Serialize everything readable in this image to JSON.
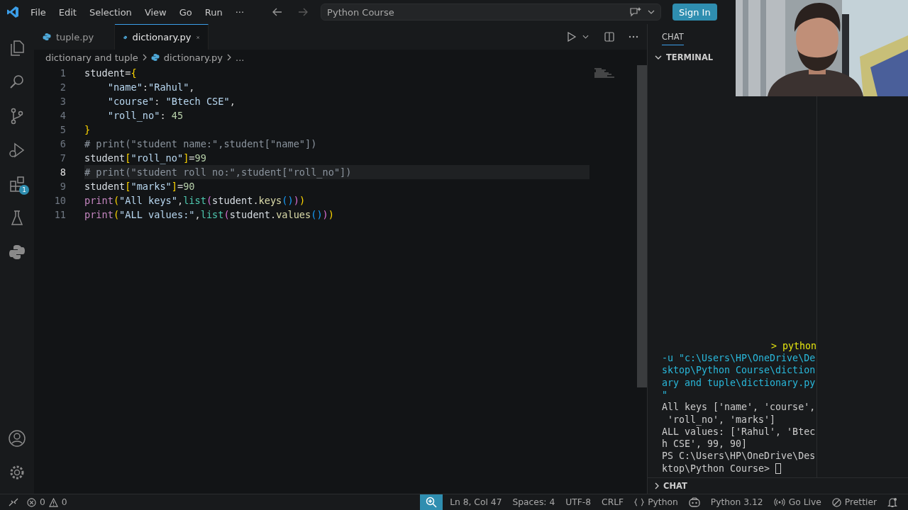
{
  "menu": [
    "File",
    "Edit",
    "Selection",
    "View",
    "Go",
    "Run",
    "···"
  ],
  "command_center": {
    "label": "Python Course"
  },
  "sign_in": "Sign In",
  "activity_bar": [
    {
      "kind": "files"
    },
    {
      "kind": "search"
    },
    {
      "kind": "source-control"
    },
    {
      "kind": "debug"
    },
    {
      "kind": "extensions",
      "badge": "1"
    },
    {
      "kind": "testing"
    },
    {
      "kind": "python"
    }
  ],
  "tabs": [
    {
      "label": "tuple.py",
      "selected": false
    },
    {
      "label": "dictionary.py",
      "selected": true
    }
  ],
  "breadcrumb": [
    "dictionary and tuple",
    "dictionary.py",
    "..."
  ],
  "code": [
    {
      "number": "1",
      "current": false,
      "tokens": [
        {
          "kind": "var",
          "text": "student"
        },
        {
          "kind": "op",
          "text": "="
        },
        {
          "kind": "brace",
          "text": "{"
        }
      ]
    },
    {
      "number": "2",
      "current": false,
      "tokens": [
        {
          "kind": "str",
          "text": "    \"name\""
        },
        {
          "kind": "op",
          "text": ":"
        },
        {
          "kind": "str",
          "text": "\"Rahul\""
        },
        {
          "kind": "op",
          "text": ","
        }
      ]
    },
    {
      "number": "3",
      "current": false,
      "tokens": [
        {
          "kind": "str",
          "text": "    \"course\""
        },
        {
          "kind": "op",
          "text": ": "
        },
        {
          "kind": "str",
          "text": "\"Btech CSE\""
        },
        {
          "kind": "op",
          "text": ","
        }
      ]
    },
    {
      "number": "4",
      "current": false,
      "tokens": [
        {
          "kind": "str",
          "text": "    \"roll_no\""
        },
        {
          "kind": "op",
          "text": ": "
        },
        {
          "kind": "num",
          "text": "45"
        }
      ]
    },
    {
      "number": "5",
      "current": false,
      "tokens": [
        {
          "kind": "brace",
          "text": "}"
        }
      ]
    },
    {
      "number": "6",
      "current": false,
      "tokens": [
        {
          "kind": "comment",
          "text": "# print(\"student name:\",student[\"name\"])"
        }
      ]
    },
    {
      "number": "7",
      "current": false,
      "tokens": [
        {
          "kind": "var",
          "text": "student"
        },
        {
          "kind": "brace",
          "text": "["
        },
        {
          "kind": "str",
          "text": "\"roll_no\""
        },
        {
          "kind": "brace",
          "text": "]"
        },
        {
          "kind": "op",
          "text": "="
        },
        {
          "kind": "num",
          "text": "99"
        }
      ]
    },
    {
      "number": "8",
      "current": true,
      "tokens": [
        {
          "kind": "comment",
          "text": "# print(\"student roll no:\",student[\"roll_no\"])"
        }
      ]
    },
    {
      "number": "9",
      "current": false,
      "tokens": [
        {
          "kind": "var",
          "text": "student"
        },
        {
          "kind": "brace",
          "text": "["
        },
        {
          "kind": "str",
          "text": "\"marks\""
        },
        {
          "kind": "brace",
          "text": "]"
        },
        {
          "kind": "op",
          "text": "="
        },
        {
          "kind": "num",
          "text": "90"
        }
      ]
    },
    {
      "number": "10",
      "current": false,
      "tokens": [
        {
          "kind": "keyword",
          "text": "print"
        },
        {
          "kind": "brace",
          "text": "("
        },
        {
          "kind": "str",
          "text": "\"All keys\""
        },
        {
          "kind": "op",
          "text": ","
        },
        {
          "kind": "type",
          "text": "list"
        },
        {
          "kind": "paren",
          "text": "("
        },
        {
          "kind": "var",
          "text": "student"
        },
        {
          "kind": "op",
          "text": "."
        },
        {
          "kind": "func",
          "text": "keys"
        },
        {
          "kind": "paren2",
          "text": "()"
        },
        {
          "kind": "paren",
          "text": ")"
        },
        {
          "kind": "brace",
          "text": ")"
        }
      ]
    },
    {
      "number": "11",
      "current": false,
      "tokens": [
        {
          "kind": "keyword",
          "text": "print"
        },
        {
          "kind": "brace",
          "text": "("
        },
        {
          "kind": "str",
          "text": "\"ALL values:\""
        },
        {
          "kind": "op",
          "text": ","
        },
        {
          "kind": "type",
          "text": "list"
        },
        {
          "kind": "paren",
          "text": "("
        },
        {
          "kind": "var",
          "text": "student"
        },
        {
          "kind": "op",
          "text": "."
        },
        {
          "kind": "func",
          "text": "values"
        },
        {
          "kind": "paren2",
          "text": "()"
        },
        {
          "kind": "paren",
          "text": ")"
        },
        {
          "kind": "brace",
          "text": ")"
        }
      ]
    }
  ],
  "panel_tab": "CHAT",
  "terminal_title": "TERMINAL",
  "terminal": [
    {
      "kind": "command",
      "text": "> python"
    },
    {
      "kind": "path",
      "text": "-u \"c:\\Users\\HP\\OneDrive\\De"
    },
    {
      "kind": "path",
      "text": "sktop\\Python Course\\diction"
    },
    {
      "kind": "path",
      "text": "ary and tuple\\dictionary.py"
    },
    {
      "kind": "path",
      "text": "\""
    },
    {
      "kind": "output",
      "text": "All keys ['name', 'course',"
    },
    {
      "kind": "output",
      "text": " 'roll_no', 'marks']"
    },
    {
      "kind": "output",
      "text": "ALL values: ['Rahul', 'Btec"
    },
    {
      "kind": "output",
      "text": "h CSE', 99, 90]"
    },
    {
      "kind": "output",
      "text": "PS C:\\Users\\HP\\OneDrive\\Des"
    },
    {
      "kind": "prompt",
      "text": "ktop\\Python Course> "
    }
  ],
  "chat_section": "CHAT",
  "status_bar": {
    "errors": "0",
    "warnings": "0",
    "position": "Ln 8, Col 47",
    "spaces": "Spaces: 4",
    "encoding": "UTF-8",
    "eol": "CRLF",
    "language": "Python",
    "interpreter": "Python 3.12",
    "go_live": "Go Live",
    "prettier": "Prettier"
  },
  "webcam": {
    "kind": "picture"
  }
}
